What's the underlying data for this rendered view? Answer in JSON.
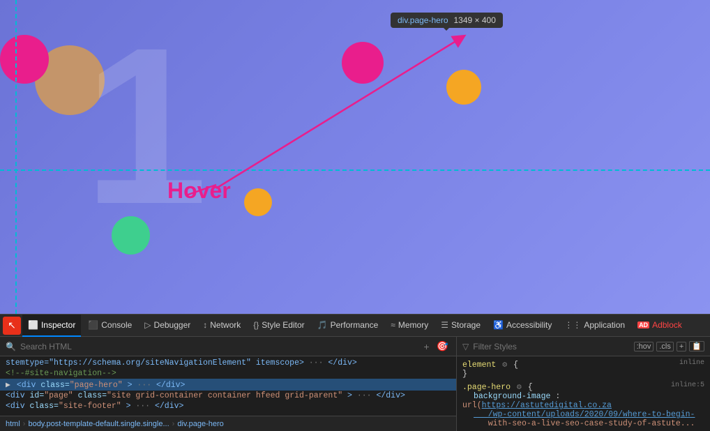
{
  "tooltip": {
    "element": "div.page-hero",
    "dimensions": "1349 × 400",
    "arrow_tip": "▼"
  },
  "hover_label": "Hover",
  "devtools": {
    "tabs": [
      {
        "id": "inspector",
        "label": "Inspector",
        "icon": "⬜",
        "active": true
      },
      {
        "id": "console",
        "label": "Console",
        "icon": "⬛"
      },
      {
        "id": "debugger",
        "label": "Debugger",
        "icon": "▷"
      },
      {
        "id": "network",
        "label": "Network",
        "icon": "↕"
      },
      {
        "id": "style-editor",
        "label": "Style Editor",
        "icon": "{}"
      },
      {
        "id": "performance",
        "label": "Performance",
        "icon": "🎵"
      },
      {
        "id": "memory",
        "label": "Memory",
        "icon": "≈"
      },
      {
        "id": "storage",
        "label": "Storage",
        "icon": "☰"
      },
      {
        "id": "accessibility",
        "label": "Accessibility",
        "icon": "♿"
      },
      {
        "id": "application",
        "label": "Application",
        "icon": "⋮⋮"
      },
      {
        "id": "adblock",
        "label": "Adblock",
        "icon": "AD"
      }
    ],
    "html_panel": {
      "search_placeholder": "Search HTML",
      "lines": [
        {
          "id": "line1",
          "content": "stemtype=\"https://schema.org/siteNavigationElement\" itemscope> ··· </div>",
          "type": "normal"
        },
        {
          "id": "line2",
          "content": "<!--#site-navigation-->",
          "type": "comment"
        },
        {
          "id": "line3",
          "content": "<div class=\"page-hero\"> ··· </div>",
          "type": "selected",
          "highlight": true
        },
        {
          "id": "line4",
          "content": "<div id=\"page\" class=\"site grid-container container hfeed grid-parent\"> ··· </div>",
          "type": "normal"
        },
        {
          "id": "line5",
          "content": "<div class=\"site-footer\"> ··· </div>",
          "type": "normal"
        }
      ],
      "breadcrumb": [
        "html",
        "body.post-template-default.single.single...",
        "div.page-hero"
      ]
    },
    "styles_panel": {
      "filter_placeholder": "Filter Styles",
      "actions": [
        ":hov",
        ".cls",
        "+",
        "📋"
      ],
      "rules": [
        {
          "selector": "element",
          "origin": "inline",
          "gear": true,
          "props": []
        },
        {
          "selector": ".page-hero",
          "origin": "inline:5",
          "gear": true,
          "props": [
            {
              "name": "background-image",
              "value": "url(https://astutedigital.co.za/wp-content/uploads/2020/09/where-to-begin-with-seo-a-live-seo-case-study-of-astute..."
            }
          ]
        }
      ]
    }
  }
}
